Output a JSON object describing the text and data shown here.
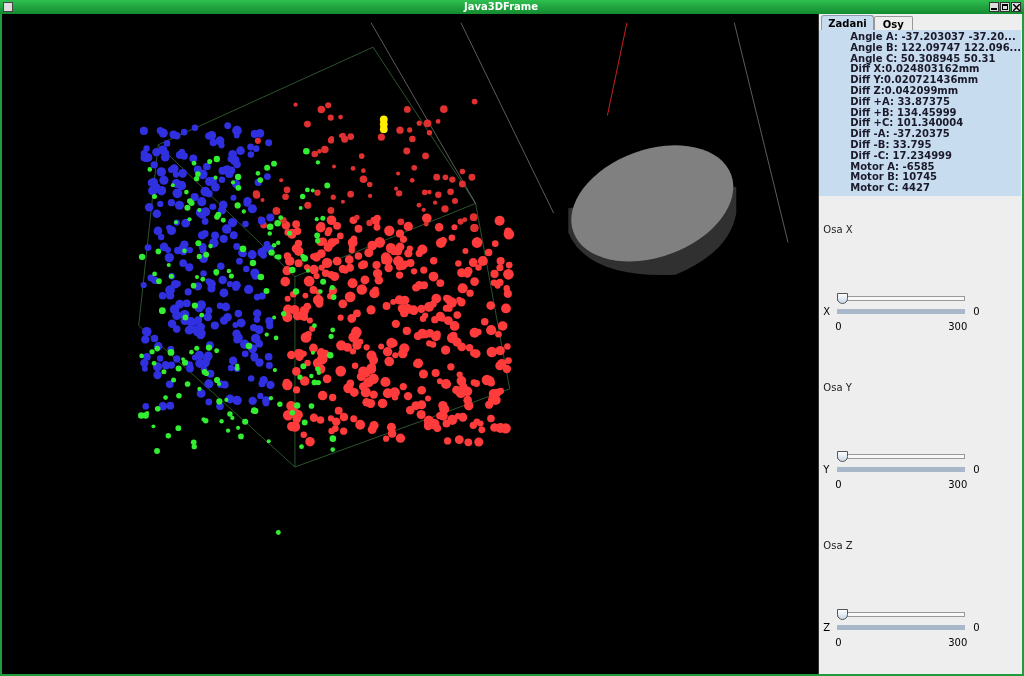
{
  "window": {
    "title": "Java3DFrame"
  },
  "tabs": [
    {
      "label": "Zadani",
      "selected": true
    },
    {
      "label": "Osy",
      "selected": false
    }
  ],
  "info_lines": [
    "Angle A: -37.203037 -37.20...",
    "Angle B: 122.09747 122.096...",
    "Angle C: 50.308945 50.31",
    "Diff X:0.024803162mm",
    "Diff Y:0.020721436mm",
    "Diff Z:0.042099mm",
    "Diff +A: 33.87375",
    "Diff +B: 134.45999",
    "Diff +C: 101.340004",
    "Diff -A: -37.20375",
    "Diff -B: 33.795",
    "Diff -C: 17.234999",
    "Motor A: -6585",
    "Motor B: 10745",
    "Motor C: 4427"
  ],
  "axes": [
    {
      "heading": "Osa X",
      "label": "X",
      "value": "0",
      "level": 0,
      "min": "0",
      "max": "300"
    },
    {
      "heading": "Osa Y",
      "label": "Y",
      "value": "0",
      "level": 0,
      "min": "0",
      "max": "300"
    },
    {
      "heading": "Osa Z",
      "label": "Z",
      "value": "0",
      "level": 0,
      "min": "0",
      "max": "300"
    }
  ]
}
